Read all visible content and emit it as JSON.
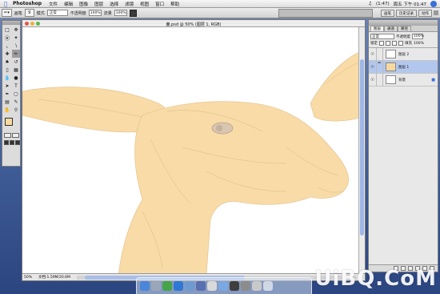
{
  "menubar": {
    "app": "Photoshop",
    "items": [
      "文件",
      "编辑",
      "图像",
      "图层",
      "选择",
      "滤镜",
      "视图",
      "窗口",
      "帮助"
    ],
    "clock": "(1:47)",
    "datetime": "周五 下午 01:47"
  },
  "options": {
    "brush_label": "画笔",
    "brush_size": "9",
    "mode_label": "模式",
    "mode_value": "正常",
    "opacity_label": "不透明度",
    "opacity_value": "100%",
    "flow_label": "流量",
    "flow_value": "100%",
    "palette_tabs": [
      "画笔",
      "历史记录",
      "动作"
    ]
  },
  "document": {
    "title": "鹿.psd @ 50% (图层 1, RGB)",
    "zoom": "50%",
    "doc_info": "文档:1.59M/20.6M"
  },
  "layers": {
    "tabs": [
      "图层",
      "通道",
      "路径"
    ],
    "blend_mode": "正常",
    "opacity_label": "不透明度",
    "opacity_value": "100%",
    "lock_label": "锁定",
    "fill_label": "填充",
    "fill_value": "100%",
    "items": [
      {
        "name": "图层 2",
        "thumb_color": "#ffffff",
        "active": false
      },
      {
        "name": "图层 1",
        "thumb_color": "#f7d9a0",
        "active": true
      },
      {
        "name": "背景",
        "thumb_color": "#ffffff",
        "active": false
      }
    ]
  },
  "colors": {
    "foreground": "#f7d9a0",
    "background": "#ffffff",
    "fill": "#f8dba7",
    "line": "#d9b98a"
  },
  "watermark": "UiBQ.CoM"
}
